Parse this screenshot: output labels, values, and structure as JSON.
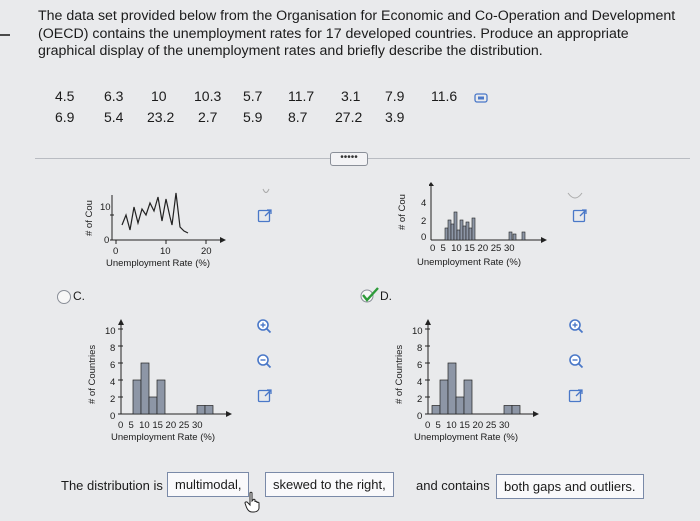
{
  "question": "The data set provided below from the Organisation for Economic and Co-Operation and Development (OECD) contains the unemployment rates for 17 developed countries. Produce an appropriate graphical display of the unemployment rates and briefly describe the distribution.",
  "data_rows": [
    [
      "4.5",
      "6.3",
      "10",
      "10.3",
      "5.7",
      "11.7",
      "3.1",
      "7.9",
      "11.6"
    ],
    [
      "6.9",
      "5.4",
      "23.2",
      "2.7",
      "5.9",
      "8.7",
      "27.2",
      "3.9"
    ]
  ],
  "expand_dots": "•••••",
  "options": {
    "c": {
      "label": "C."
    },
    "d": {
      "label": "D."
    }
  },
  "plots": {
    "a": {
      "ylabel": "# of Cou",
      "xlabel": "Unemployment Rate (%)",
      "yticks": [
        "10"
      ],
      "ytick_zero": "0",
      "xticks": [
        "0",
        "10",
        "20"
      ]
    },
    "b": {
      "ylabel": "# of Cou",
      "xlabel": "Unemployment Rate (%)",
      "yticks": [
        "4",
        "2",
        "0"
      ],
      "xticks_text": "0  5  10 15 20 25 30"
    },
    "c": {
      "ylabel": "# of Countries",
      "xlabel": "Unemployment Rate (%)",
      "yticks": [
        "10",
        "8",
        "6",
        "4",
        "2",
        "0"
      ],
      "xticks_text": "0  5  10 15 20 25 30",
      "chart_data": {
        "type": "bar",
        "categories": [
          "0-2.5",
          "2.5-5",
          "5-7.5",
          "7.5-10",
          "10-12.5",
          "12.5-15",
          "15-17.5",
          "17.5-20",
          "20-22.5",
          "22.5-25",
          "25-27.5",
          "27.5-30"
        ],
        "values": [
          0,
          4,
          6,
          2,
          4,
          0,
          0,
          0,
          0,
          1,
          1,
          0
        ],
        "ylim": [
          0,
          10
        ]
      }
    },
    "d": {
      "ylabel": "# of Countries",
      "xlabel": "Unemployment Rate (%)",
      "yticks": [
        "10",
        "8",
        "6",
        "4",
        "2",
        "0"
      ],
      "xticks_text": "0  5  10 15 20 25 30",
      "chart_data": {
        "type": "bar",
        "categories": [
          "0-2.5",
          "2.5-5",
          "5-7.5",
          "7.5-10",
          "10-12.5",
          "12.5-15",
          "15-17.5",
          "17.5-20",
          "20-22.5",
          "22.5-25",
          "25-27.5",
          "27.5-30"
        ],
        "values": [
          1,
          4,
          6,
          2,
          4,
          0,
          0,
          0,
          0,
          1,
          1,
          0
        ],
        "ylim": [
          0,
          10
        ]
      }
    }
  },
  "answer": {
    "prefix": "The distribution is",
    "choice1": "multimodal,",
    "choice2": "skewed to the right,",
    "middle": "and contains",
    "choice3": "both gaps and outliers."
  }
}
